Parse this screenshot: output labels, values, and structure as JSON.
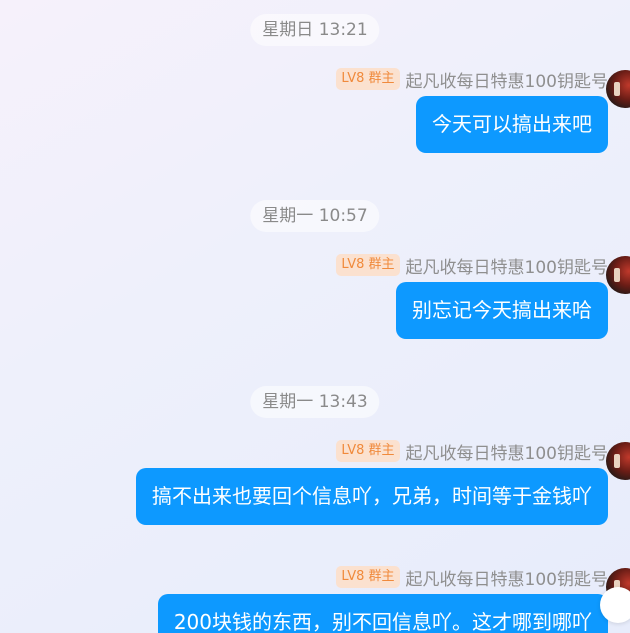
{
  "messages": [
    {
      "time": "星期日 13:21",
      "badge": "LV8 群主",
      "sender": "起凡收每日特惠100钥匙号",
      "text": "今天可以搞出来吧"
    },
    {
      "time": "星期一 10:57",
      "badge": "LV8 群主",
      "sender": "起凡收每日特惠100钥匙号",
      "text": "别忘记今天搞出来哈"
    },
    {
      "time": "星期一 13:43",
      "badge": "LV8 群主",
      "sender": "起凡收每日特惠100钥匙号",
      "text": "搞不出来也要回个信息吖，兄弟，时间等于金钱吖"
    },
    {
      "badge": "LV8 群主",
      "sender": "起凡收每日特惠100钥匙号",
      "text": "200块钱的东西，别不回信息吖。这才哪到哪吖"
    }
  ],
  "colors": {
    "bubble": "#0d99ff",
    "badge_bg": "#fbe1cf",
    "badge_text": "#f08a3c",
    "time_text": "#8a8a8a"
  },
  "icons": {
    "avatar": "group-owner-avatar",
    "fab": "floating-action-button"
  }
}
